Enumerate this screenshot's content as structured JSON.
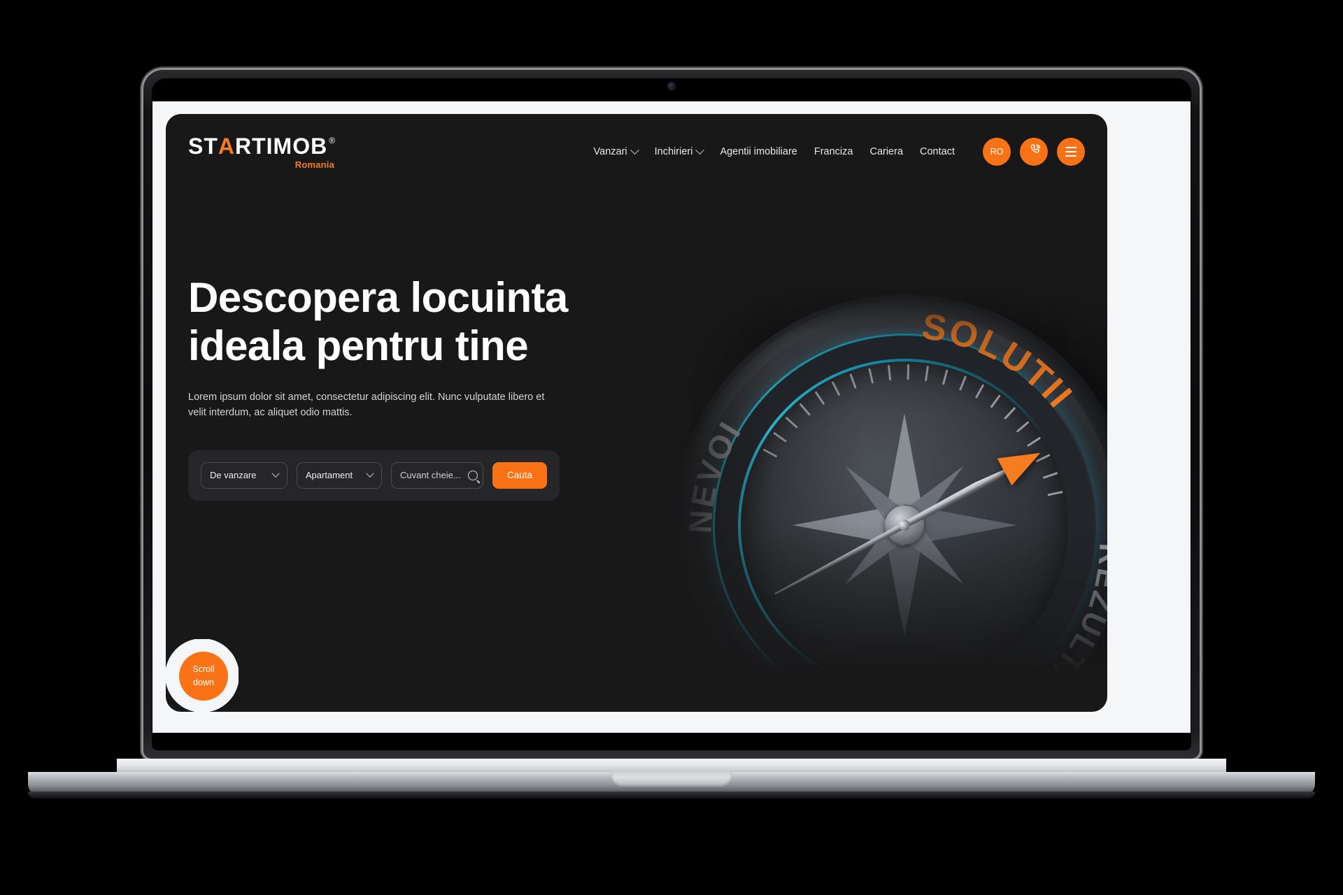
{
  "header": {
    "logo": {
      "part1": "ST",
      "accent_letter": "A",
      "part2": "RTIMOB",
      "registered": "®",
      "subtitle": "Romania"
    },
    "nav": [
      {
        "label": "Vanzari",
        "has_dropdown": true
      },
      {
        "label": "Inchirieri",
        "has_dropdown": true
      },
      {
        "label": "Agentii imobiliare",
        "has_dropdown": false
      },
      {
        "label": "Franciza",
        "has_dropdown": false
      },
      {
        "label": "Cariera",
        "has_dropdown": false
      },
      {
        "label": "Contact",
        "has_dropdown": false
      }
    ],
    "actions": {
      "language": "RO",
      "phone_icon": "phone-ring-icon",
      "menu_icon": "hamburger-menu-icon"
    }
  },
  "hero": {
    "title_line1": "Descopera locuinta",
    "title_line2": "ideala pentru tine",
    "subtitle": "Lorem ipsum dolor sit amet, consectetur adipiscing elit. Nunc vulputate libero et velit interdum, ac aliquet odio mattis.",
    "search": {
      "transaction_type": "De vanzare",
      "property_type": "Apartament",
      "keyword_placeholder": "Cuvant cheie...",
      "keyword_value": "",
      "search_icon": "magnifier-icon",
      "submit_label": "Cauta"
    },
    "scroll_button": {
      "line1": "Scroll",
      "line2": "down"
    },
    "artwork": {
      "type": "compass-image",
      "labels": {
        "left": "NEVOI",
        "top": "SOLUTII",
        "right": "REZULTATE"
      }
    }
  },
  "colors": {
    "accent": "#f97316",
    "accent_logo": "#f57c1f",
    "panel_bg": "#181819",
    "page_bg": "#f5f6f8",
    "search_bg": "#262628",
    "text_primary": "#ffffff",
    "text_secondary": "#d3d4d6",
    "compass_cyan": "#22cbe8"
  }
}
